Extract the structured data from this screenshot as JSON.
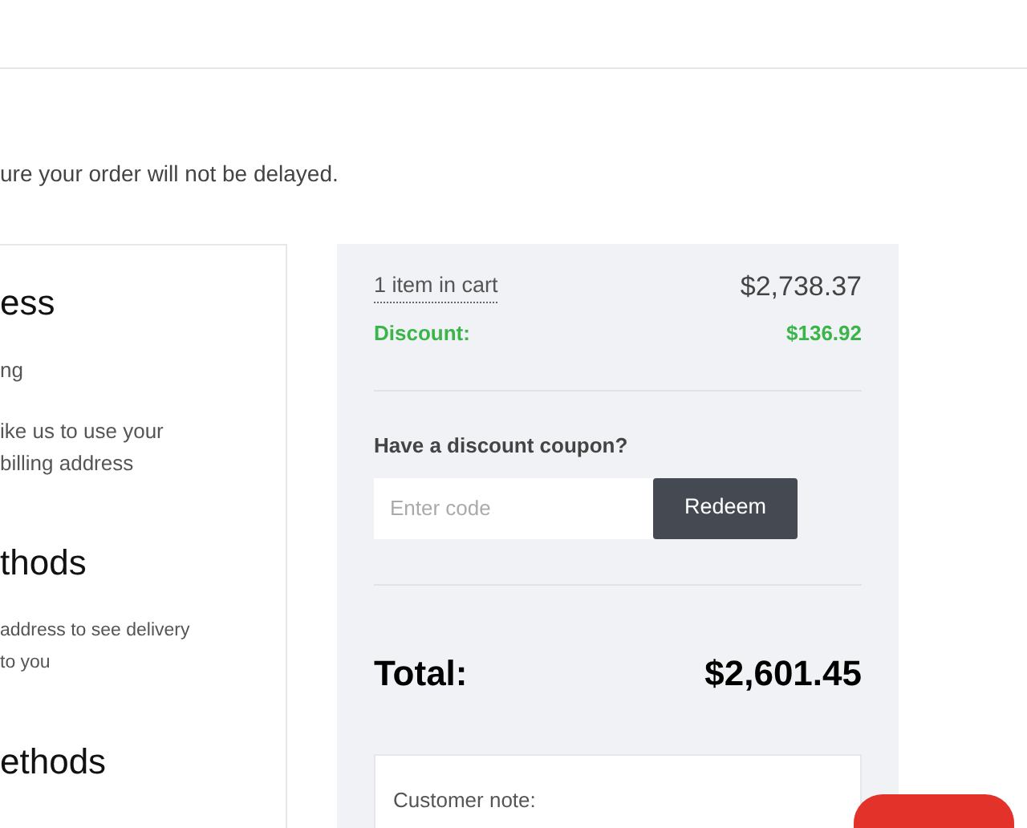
{
  "notice": "ure your order will not be delayed.",
  "left_panel": {
    "sections": [
      {
        "heading": "ess",
        "lines": [
          "ng",
          "ike us to use your",
          "billing address"
        ]
      },
      {
        "heading": "thods",
        "lines": [
          "address to see delivery",
          "to you"
        ]
      },
      {
        "heading": "ethods"
      }
    ]
  },
  "summary": {
    "cart_link": "1 item in cart",
    "subtotal": "$2,738.37",
    "discount_label": "Discount:",
    "discount": "$136.92",
    "coupon": {
      "label": "Have a discount coupon?",
      "placeholder": "Enter code",
      "button": "Redeem"
    },
    "total_label": "Total:",
    "total": "$2,601.45",
    "note_label": "Customer note:"
  }
}
